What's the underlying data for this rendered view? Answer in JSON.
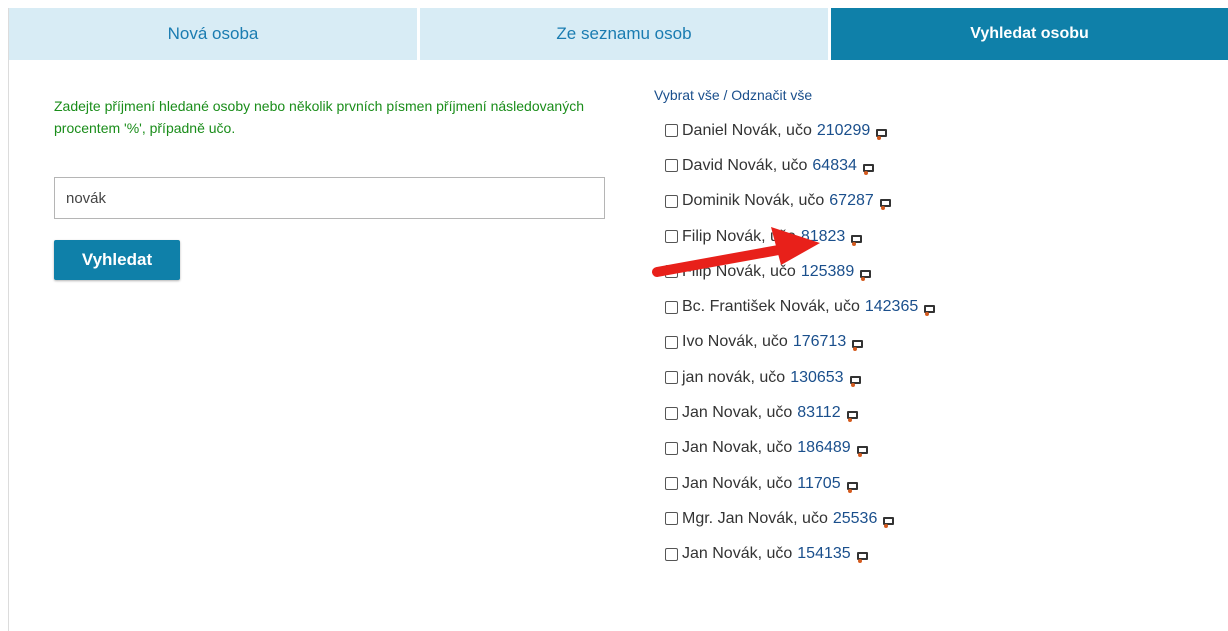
{
  "tabs": [
    {
      "label": "Nová osoba",
      "active": false
    },
    {
      "label": "Ze seznamu osob",
      "active": false
    },
    {
      "label": "Vyhledat osobu",
      "active": true
    }
  ],
  "search": {
    "instructions": "Zadejte příjmení hledané osoby nebo několik prvních písmen příjmení následovaných procentem '%', případně učo.",
    "value": "novák",
    "button_label": "Vyhledat"
  },
  "selection": {
    "select_all": "Vybrat vše",
    "separator": "/",
    "deselect_all": "Odznačit vše"
  },
  "results": [
    {
      "name": "Daniel Novák, učo",
      "uco": "210299"
    },
    {
      "name": "David Novák, učo",
      "uco": "64834"
    },
    {
      "name": "Dominik Novák, učo",
      "uco": "67287"
    },
    {
      "name": "Filip Novák, učo",
      "uco": "81823"
    },
    {
      "name": "Filip Novák, učo",
      "uco": "125389"
    },
    {
      "name": "Bc. František Novák, učo",
      "uco": "142365"
    },
    {
      "name": "Ivo Novák, učo",
      "uco": "176713"
    },
    {
      "name": "jan novák, učo",
      "uco": "130653"
    },
    {
      "name": "Jan Novak, učo",
      "uco": "83112"
    },
    {
      "name": "Jan Novak, učo",
      "uco": "186489"
    },
    {
      "name": "Jan Novák, učo",
      "uco": "11705"
    },
    {
      "name": "Mgr. Jan Novák, učo",
      "uco": "25536"
    },
    {
      "name": "Jan Novák, učo",
      "uco": "154135"
    }
  ],
  "colors": {
    "accent": "#0f80a9",
    "tab_inactive_bg": "#d8ecf5",
    "instruction_text": "#1a8d1a",
    "link": "#1a4f8c",
    "annotation_arrow": "#e8201a"
  },
  "icons": {
    "result_action": "card-icon",
    "annotation": "red-arrow"
  }
}
